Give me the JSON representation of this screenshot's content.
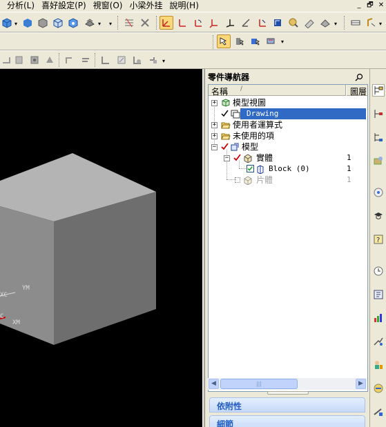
{
  "menu": {
    "items": [
      "分析(L)",
      "喜好設定(P)",
      "視窗(O)",
      "小梁外挂",
      "說明(H)"
    ]
  },
  "window_controls": [
    "_",
    "🗗",
    "✕"
  ],
  "viewport": {
    "background": "#000000",
    "cube_colors": {
      "top": "#b4b4b4",
      "left": "#8c8c8c",
      "front": "#6e6e6e"
    },
    "axis_labels": {
      "ym": "YM",
      "xc": "XC",
      "xm": "XM",
      "c": "C"
    }
  },
  "navigator": {
    "title": "零件導航器",
    "column_name": "名稱",
    "column_sort": "/",
    "column_layer": "圖層",
    "tree": [
      {
        "label": "模型視圖",
        "layer": ""
      },
      {
        "label": "Drawing",
        "layer": ""
      },
      {
        "label": "使用者運算式",
        "layer": ""
      },
      {
        "label": "未使用的項",
        "layer": ""
      },
      {
        "label": "模型",
        "layer": ""
      },
      {
        "label": "實體",
        "layer": "1"
      },
      {
        "label": "Block (0)",
        "layer": "1"
      },
      {
        "label": "片體",
        "layer": "1"
      }
    ],
    "scroll_thumb": "|||",
    "sections": [
      "依附性",
      "細節"
    ]
  },
  "colors": {
    "selection": "#316ac5",
    "section_title": "#215dc6",
    "active_tool": "#fbd97a"
  }
}
